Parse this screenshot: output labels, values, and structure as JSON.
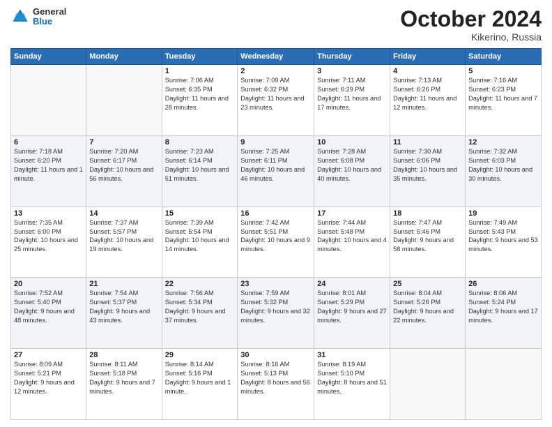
{
  "header": {
    "logo_general": "General",
    "logo_blue": "Blue",
    "month_title": "October 2024",
    "location": "Kikerino, Russia"
  },
  "weekdays": [
    "Sunday",
    "Monday",
    "Tuesday",
    "Wednesday",
    "Thursday",
    "Friday",
    "Saturday"
  ],
  "weeks": [
    [
      {
        "day": "",
        "info": ""
      },
      {
        "day": "",
        "info": ""
      },
      {
        "day": "1",
        "info": "Sunrise: 7:06 AM\nSunset: 6:35 PM\nDaylight: 11 hours and 28 minutes."
      },
      {
        "day": "2",
        "info": "Sunrise: 7:09 AM\nSunset: 6:32 PM\nDaylight: 11 hours and 23 minutes."
      },
      {
        "day": "3",
        "info": "Sunrise: 7:11 AM\nSunset: 6:29 PM\nDaylight: 11 hours and 17 minutes."
      },
      {
        "day": "4",
        "info": "Sunrise: 7:13 AM\nSunset: 6:26 PM\nDaylight: 11 hours and 12 minutes."
      },
      {
        "day": "5",
        "info": "Sunrise: 7:16 AM\nSunset: 6:23 PM\nDaylight: 11 hours and 7 minutes."
      }
    ],
    [
      {
        "day": "6",
        "info": "Sunrise: 7:18 AM\nSunset: 6:20 PM\nDaylight: 11 hours and 1 minute."
      },
      {
        "day": "7",
        "info": "Sunrise: 7:20 AM\nSunset: 6:17 PM\nDaylight: 10 hours and 56 minutes."
      },
      {
        "day": "8",
        "info": "Sunrise: 7:23 AM\nSunset: 6:14 PM\nDaylight: 10 hours and 51 minutes."
      },
      {
        "day": "9",
        "info": "Sunrise: 7:25 AM\nSunset: 6:11 PM\nDaylight: 10 hours and 46 minutes."
      },
      {
        "day": "10",
        "info": "Sunrise: 7:28 AM\nSunset: 6:08 PM\nDaylight: 10 hours and 40 minutes."
      },
      {
        "day": "11",
        "info": "Sunrise: 7:30 AM\nSunset: 6:06 PM\nDaylight: 10 hours and 35 minutes."
      },
      {
        "day": "12",
        "info": "Sunrise: 7:32 AM\nSunset: 6:03 PM\nDaylight: 10 hours and 30 minutes."
      }
    ],
    [
      {
        "day": "13",
        "info": "Sunrise: 7:35 AM\nSunset: 6:00 PM\nDaylight: 10 hours and 25 minutes."
      },
      {
        "day": "14",
        "info": "Sunrise: 7:37 AM\nSunset: 5:57 PM\nDaylight: 10 hours and 19 minutes."
      },
      {
        "day": "15",
        "info": "Sunrise: 7:39 AM\nSunset: 5:54 PM\nDaylight: 10 hours and 14 minutes."
      },
      {
        "day": "16",
        "info": "Sunrise: 7:42 AM\nSunset: 5:51 PM\nDaylight: 10 hours and 9 minutes."
      },
      {
        "day": "17",
        "info": "Sunrise: 7:44 AM\nSunset: 5:48 PM\nDaylight: 10 hours and 4 minutes."
      },
      {
        "day": "18",
        "info": "Sunrise: 7:47 AM\nSunset: 5:46 PM\nDaylight: 9 hours and 58 minutes."
      },
      {
        "day": "19",
        "info": "Sunrise: 7:49 AM\nSunset: 5:43 PM\nDaylight: 9 hours and 53 minutes."
      }
    ],
    [
      {
        "day": "20",
        "info": "Sunrise: 7:52 AM\nSunset: 5:40 PM\nDaylight: 9 hours and 48 minutes."
      },
      {
        "day": "21",
        "info": "Sunrise: 7:54 AM\nSunset: 5:37 PM\nDaylight: 9 hours and 43 minutes."
      },
      {
        "day": "22",
        "info": "Sunrise: 7:56 AM\nSunset: 5:34 PM\nDaylight: 9 hours and 37 minutes."
      },
      {
        "day": "23",
        "info": "Sunrise: 7:59 AM\nSunset: 5:32 PM\nDaylight: 9 hours and 32 minutes."
      },
      {
        "day": "24",
        "info": "Sunrise: 8:01 AM\nSunset: 5:29 PM\nDaylight: 9 hours and 27 minutes."
      },
      {
        "day": "25",
        "info": "Sunrise: 8:04 AM\nSunset: 5:26 PM\nDaylight: 9 hours and 22 minutes."
      },
      {
        "day": "26",
        "info": "Sunrise: 8:06 AM\nSunset: 5:24 PM\nDaylight: 9 hours and 17 minutes."
      }
    ],
    [
      {
        "day": "27",
        "info": "Sunrise: 8:09 AM\nSunset: 5:21 PM\nDaylight: 9 hours and 12 minutes."
      },
      {
        "day": "28",
        "info": "Sunrise: 8:11 AM\nSunset: 5:18 PM\nDaylight: 9 hours and 7 minutes."
      },
      {
        "day": "29",
        "info": "Sunrise: 8:14 AM\nSunset: 5:16 PM\nDaylight: 9 hours and 1 minute."
      },
      {
        "day": "30",
        "info": "Sunrise: 8:16 AM\nSunset: 5:13 PM\nDaylight: 8 hours and 56 minutes."
      },
      {
        "day": "31",
        "info": "Sunrise: 8:19 AM\nSunset: 5:10 PM\nDaylight: 8 hours and 51 minutes."
      },
      {
        "day": "",
        "info": ""
      },
      {
        "day": "",
        "info": ""
      }
    ]
  ]
}
